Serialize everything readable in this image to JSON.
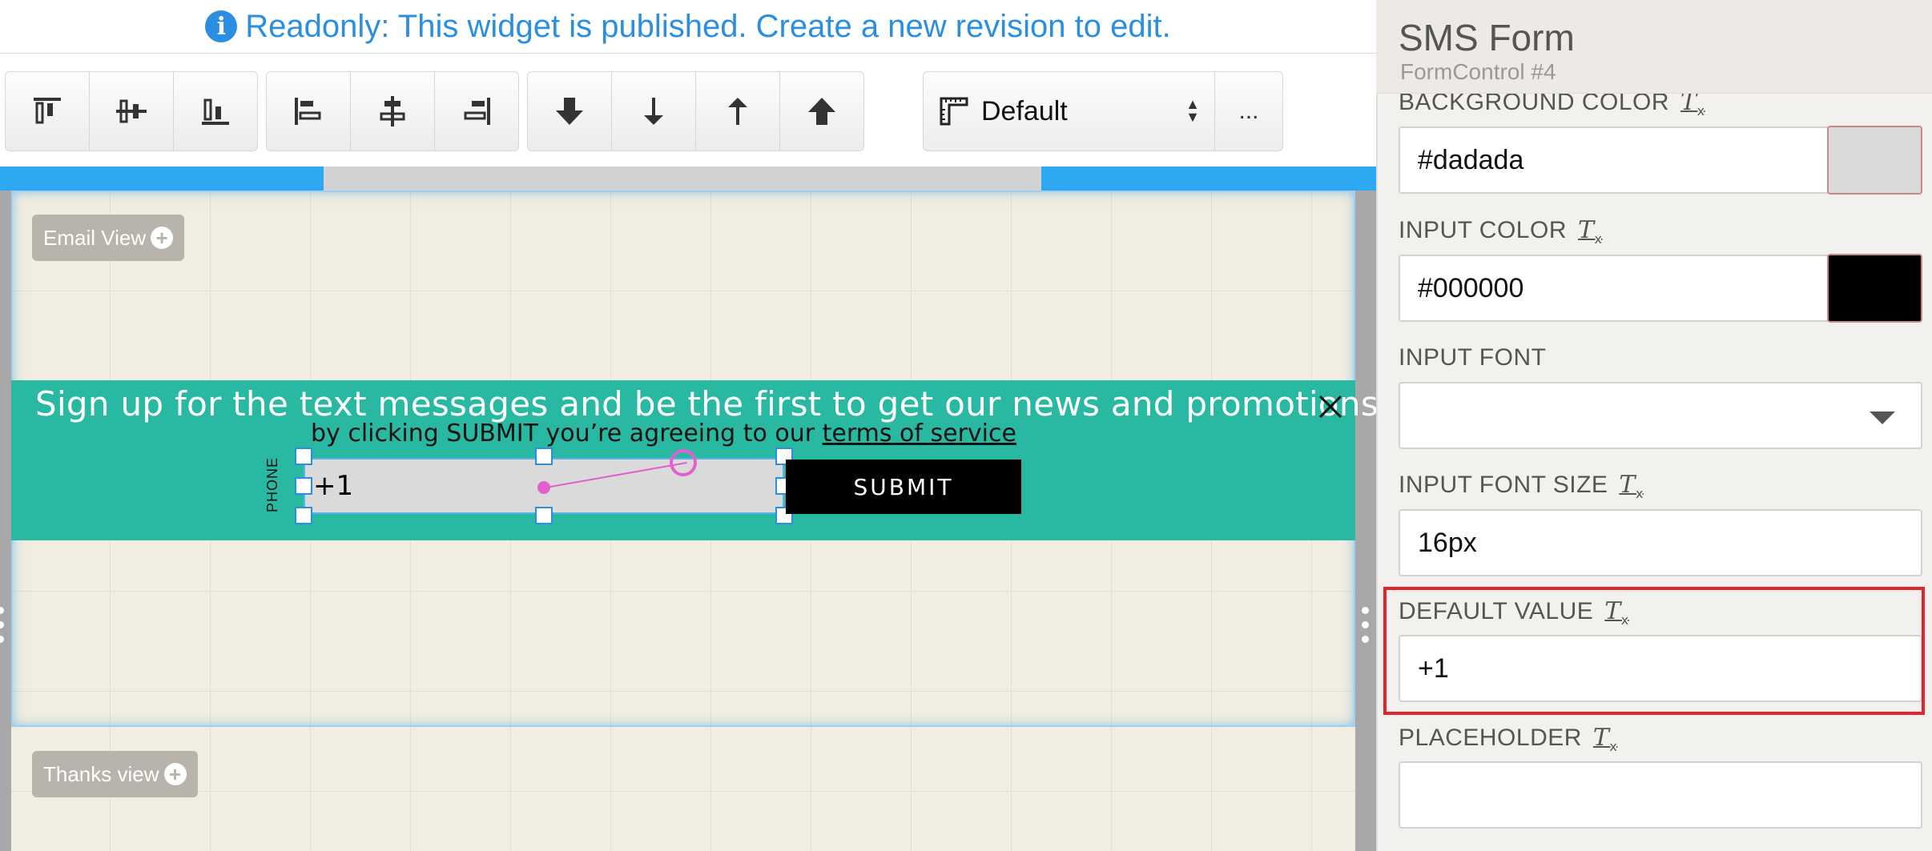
{
  "readonly_bar": {
    "icon": "info-icon",
    "icon_glyph": "i",
    "message": "Readonly: This widget is published. Create a new revision to edit."
  },
  "toolbar": {
    "align_buttons": [
      "align-top-icon",
      "align-middle-icon",
      "align-bottom-icon"
    ],
    "distribute_buttons": [
      "align-left-icon",
      "align-center-icon",
      "align-right-icon"
    ],
    "order_buttons": [
      "send-to-back-icon",
      "send-backward-icon",
      "bring-forward-icon",
      "bring-to-front-icon"
    ],
    "breakpoint_select": {
      "value": "Default",
      "icon": "ruler-icon"
    },
    "more_label": "..."
  },
  "canvas": {
    "email_view_tag": "Email View",
    "thanks_view_tag": "Thanks view",
    "banner": {
      "title": "Sign up for the text messages and be the first to get our news and promotions",
      "disclaimer_prefix": "by clicking SUBMIT you’re agreeing to our ",
      "disclaimer_link": "terms of service",
      "phone_label": "PHONE",
      "phone_value": "+1",
      "submit_label": "SUBMIT",
      "close_icon": "close-icon"
    }
  },
  "panel": {
    "title": "SMS Form",
    "subtitle": "FormControl #4",
    "fields": {
      "background_color": {
        "label": "BACKGROUND COLOR",
        "value": "#dadada",
        "swatch": "#dadada"
      },
      "input_color": {
        "label": "INPUT COLOR",
        "value": "#000000",
        "swatch": "#000000"
      },
      "input_font": {
        "label": "INPUT FONT",
        "value": ""
      },
      "input_font_size": {
        "label": "INPUT FONT SIZE",
        "value": "16px"
      },
      "default_value": {
        "label": "DEFAULT VALUE",
        "value": "+1"
      },
      "placeholder": {
        "label": "PLACEHOLDER",
        "value": ""
      }
    },
    "clear_format_glyph": "T"
  },
  "colors": {
    "accent": "#2a8fe0",
    "banner": "#29b9a3",
    "highlight": "#e0252e",
    "handle": "#e35fd0"
  }
}
